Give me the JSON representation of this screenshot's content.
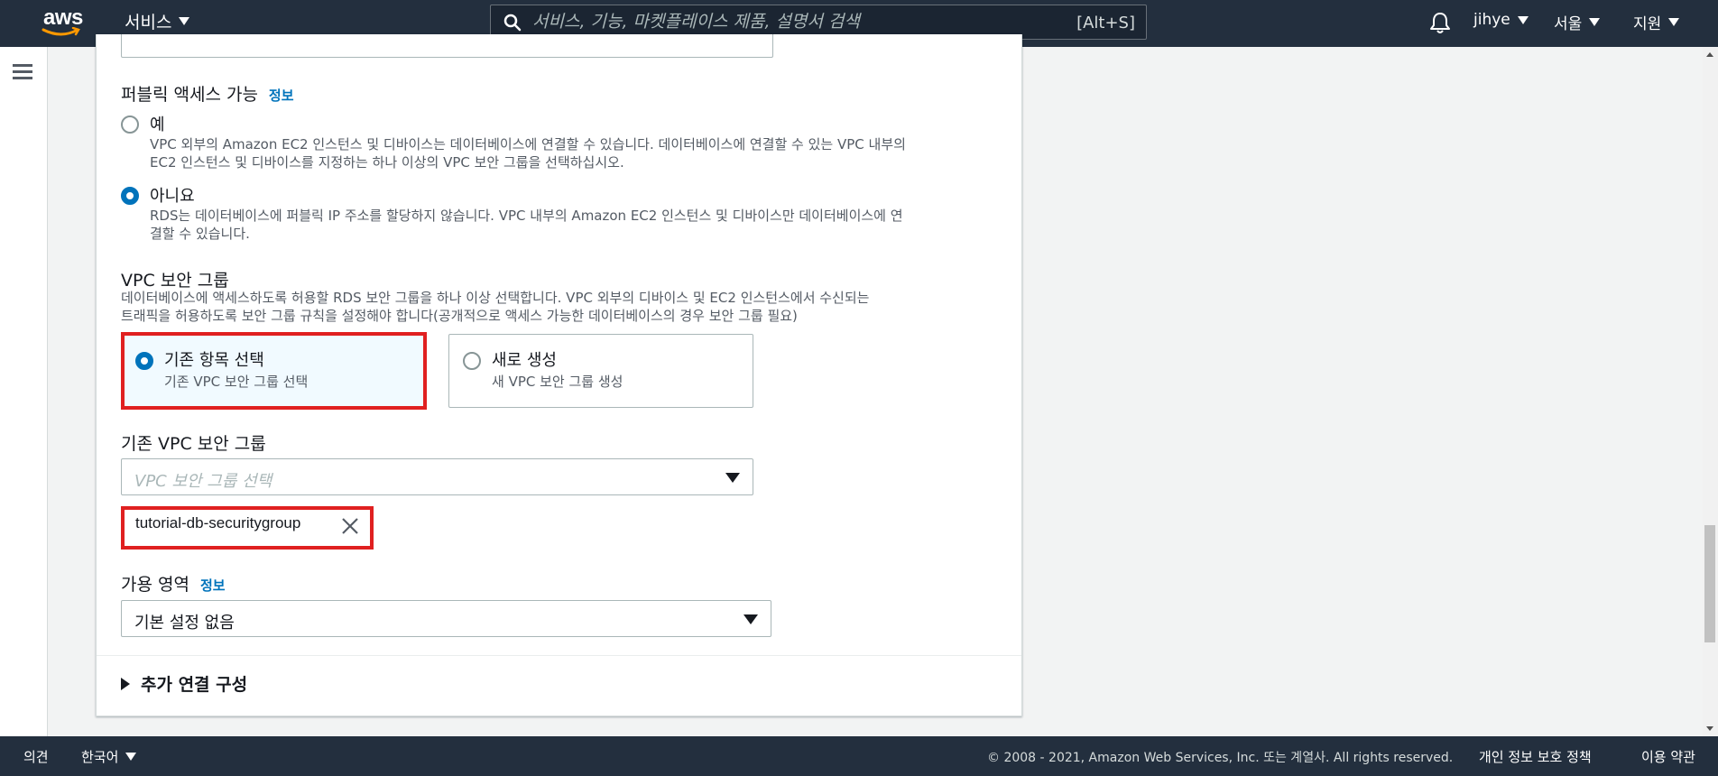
{
  "topnav": {
    "logo_text": "aws",
    "services_label": "서비스",
    "search_placeholder": "서비스, 기능, 마켓플레이스 제품, 설명서 검색",
    "search_shortcut": "[Alt+S]",
    "user_label": "jihye",
    "region_label": "서울",
    "support_label": "지원"
  },
  "public_access": {
    "title": "퍼블릭 액세스 가능",
    "info_label": "정보",
    "options": [
      {
        "label": "예",
        "description_line1": "VPC 외부의 Amazon EC2 인스턴스 및 디바이스는 데이터베이스에 연결할 수 있습니다. 데이터베이스에 연결할 수 있는 VPC 내부의",
        "description_line2": "EC2 인스턴스 및 디바이스를 지정하는 하나 이상의 VPC 보안 그룹을 선택하십시오.",
        "selected": false
      },
      {
        "label": "아니요",
        "description_line1": "RDS는 데이터베이스에 퍼블릭 IP 주소를 할당하지 않습니다. VPC 내부의 Amazon EC2 인스턴스 및 디바이스만 데이터베이스에 연",
        "description_line2": "결할 수 있습니다.",
        "selected": true
      }
    ]
  },
  "vpc_security_group": {
    "title": "VPC 보안 그룹",
    "description_line1": "데이터베이스에 액세스하도록 허용할 RDS 보안 그룹을 하나 이상 선택합니다. VPC 외부의 디바이스 및 EC2 인스턴스에서 수신되는",
    "description_line2": "트래픽을 허용하도록 보안 그룹 규칙을 설정해야 합니다(공개적으로 액세스 가능한 데이터베이스의 경우 보안 그룹 필요)",
    "tiles": [
      {
        "title": "기존 항목 선택",
        "subtitle": "기존 VPC 보안 그룹 선택",
        "selected": true
      },
      {
        "title": "새로 생성",
        "subtitle": "새 VPC 보안 그룹 생성",
        "selected": false
      }
    ]
  },
  "existing_vpc_sg": {
    "label": "기존 VPC 보안 그룹",
    "placeholder": "VPC 보안 그룹 선택",
    "selected_tokens": [
      "tutorial-db-securitygroup"
    ]
  },
  "availability_zone": {
    "label": "가용 영역",
    "info_label": "정보",
    "value": "기본 설정 없음"
  },
  "additional_config": {
    "label": "추가 연결 구성"
  },
  "footer": {
    "feedback": "의견",
    "language": "한국어",
    "copyright": "© 2008 - 2021, Amazon Web Services, Inc. 또는 계열사. All rights reserved.",
    "privacy": "개인 정보 보호 정책",
    "terms": "이용 약관"
  },
  "colors": {
    "nav_bg": "#232f3e",
    "accent": "#0073bb",
    "highlight": "#e02020",
    "aws_orange": "#ff9900"
  }
}
